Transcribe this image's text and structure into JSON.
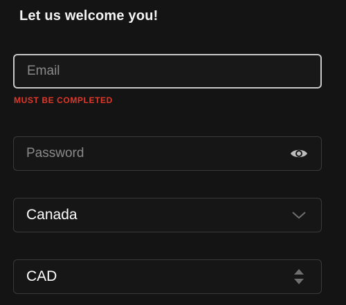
{
  "form": {
    "title": "Let us welcome you!",
    "email": {
      "placeholder": "Email",
      "value": "",
      "error": "MUST BE COMPLETED"
    },
    "password": {
      "placeholder": "Password",
      "value": "",
      "toggle_icon": "eye-icon"
    },
    "country": {
      "selected": "Canada",
      "icon": "chevron-down-icon"
    },
    "currency": {
      "selected": "CAD",
      "icon": "sort-arrows-icon"
    }
  },
  "colors": {
    "background": "#141414",
    "error": "#e0382a",
    "field_border": "#3a3a3a",
    "focus_border": "#c9c9c9"
  }
}
